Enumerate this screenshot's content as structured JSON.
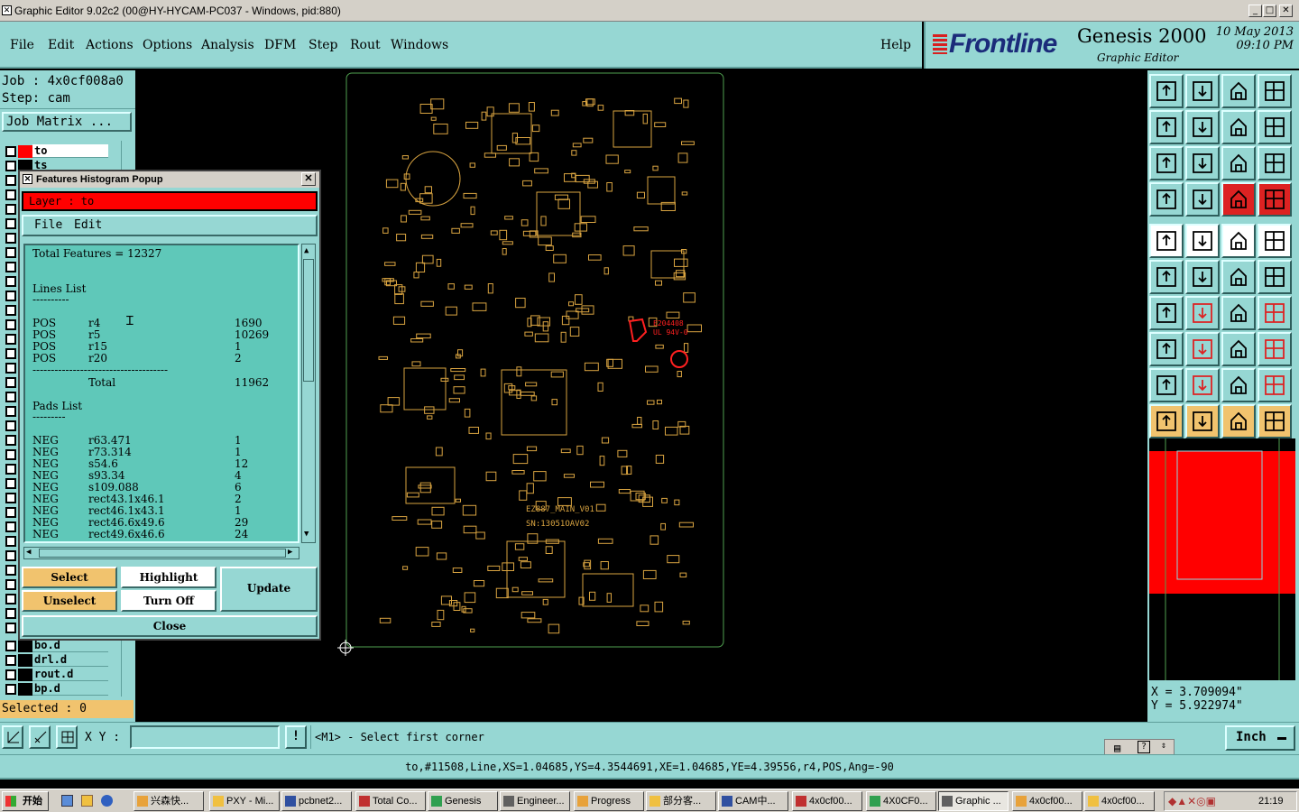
{
  "titlebar": {
    "title": "Graphic Editor 9.02c2 (00@HY-HYCAM-PC037 - Windows, pid:880)",
    "minimize": "_",
    "maximize": "□",
    "close": "✕"
  },
  "menu": {
    "items": [
      "File",
      "Edit",
      "Actions",
      "Options",
      "Analysis",
      "DFM",
      "Step",
      "Rout",
      "Windows"
    ],
    "help": "Help"
  },
  "brand": {
    "logo": "Frontline",
    "product": "Genesis 2000",
    "subtitle": "Graphic Editor",
    "date": "10 May 2013",
    "time": "09:10 PM"
  },
  "left": {
    "job_label": "Job : 4x0cf008a0",
    "step_label": "Step: cam",
    "job_matrix": "Job Matrix ...",
    "layers_top": [
      "to",
      "ts"
    ],
    "layers_bottom": [
      "bo.d",
      "drl.d",
      "rout.d",
      "bp.d"
    ],
    "selected": "Selected : 0"
  },
  "popup": {
    "title": "Features Histogram Popup",
    "layer": "Layer :  to",
    "menu": [
      "File",
      "Edit"
    ],
    "total_features": "Total Features = 12327",
    "lines_heading": "Lines List",
    "lines_rule": "----------",
    "lines": [
      {
        "pol": "POS",
        "sym": "r4",
        "count": "1690"
      },
      {
        "pol": "POS",
        "sym": "r5",
        "count": "10269"
      },
      {
        "pol": "POS",
        "sym": "r15",
        "count": "1"
      },
      {
        "pol": "POS",
        "sym": "r20",
        "count": "2"
      }
    ],
    "lines_sep": "-------------------------------------",
    "lines_total_label": "Total",
    "lines_total": "11962",
    "pads_heading": "Pads List",
    "pads_rule": "---------",
    "pads": [
      {
        "pol": "NEG",
        "sym": "r63.471",
        "count": "1"
      },
      {
        "pol": "NEG",
        "sym": "r73.314",
        "count": "1"
      },
      {
        "pol": "NEG",
        "sym": "s54.6",
        "count": "12"
      },
      {
        "pol": "NEG",
        "sym": "s93.34",
        "count": "4"
      },
      {
        "pol": "NEG",
        "sym": "s109.088",
        "count": "6"
      },
      {
        "pol": "NEG",
        "sym": "rect43.1x46.1",
        "count": "2"
      },
      {
        "pol": "NEG",
        "sym": "rect46.1x43.1",
        "count": "1"
      },
      {
        "pol": "NEG",
        "sym": "rect46.6x49.6",
        "count": "29"
      },
      {
        "pol": "NEG",
        "sym": "rect49.6x46.6",
        "count": "24"
      }
    ],
    "buttons": {
      "select": "Select",
      "highlight": "Highlight",
      "update": "Update",
      "unselect": "Unselect",
      "turn_off": "Turn Off",
      "close": "Close"
    }
  },
  "board": {
    "label1": "EZ887_MAIN_V01",
    "label2": "SN:13051OAV02",
    "marking1": "E204408",
    "marking2": "UL 94V-0"
  },
  "right": {
    "x_coord": "X  =  3.709094\"",
    "y_coord": "Y  =  5.922974\"",
    "units": "Inch"
  },
  "bottom": {
    "xy_label": "X Y :",
    "xy_value": "",
    "prompt": "<M1> - Select first corner",
    "status": "to,#11508,Line,XS=1.04685,YS=4.3544691,XE=1.04685,YE=4.39556,r4,POS,Ang=-90"
  },
  "taskbar": {
    "start": "开始",
    "tasks": [
      "兴森快...",
      "PXY - Mi...",
      "pcbnet2...",
      "Total Co...",
      "Genesis",
      "Engineer...",
      "Progress",
      "部分客...",
      "CAM中...",
      "4x0cf00...",
      "4X0CF0...",
      "Graphic ...",
      "4x0cf00...",
      "4x0cf00..."
    ],
    "active_index": 11,
    "clock": "21:19"
  },
  "colors": {
    "teal": "#96d7d3",
    "layer_red": "#ff0000",
    "feature": "#d9a441",
    "profile": "#4f9f4f",
    "button_orange": "#f1c36e"
  }
}
